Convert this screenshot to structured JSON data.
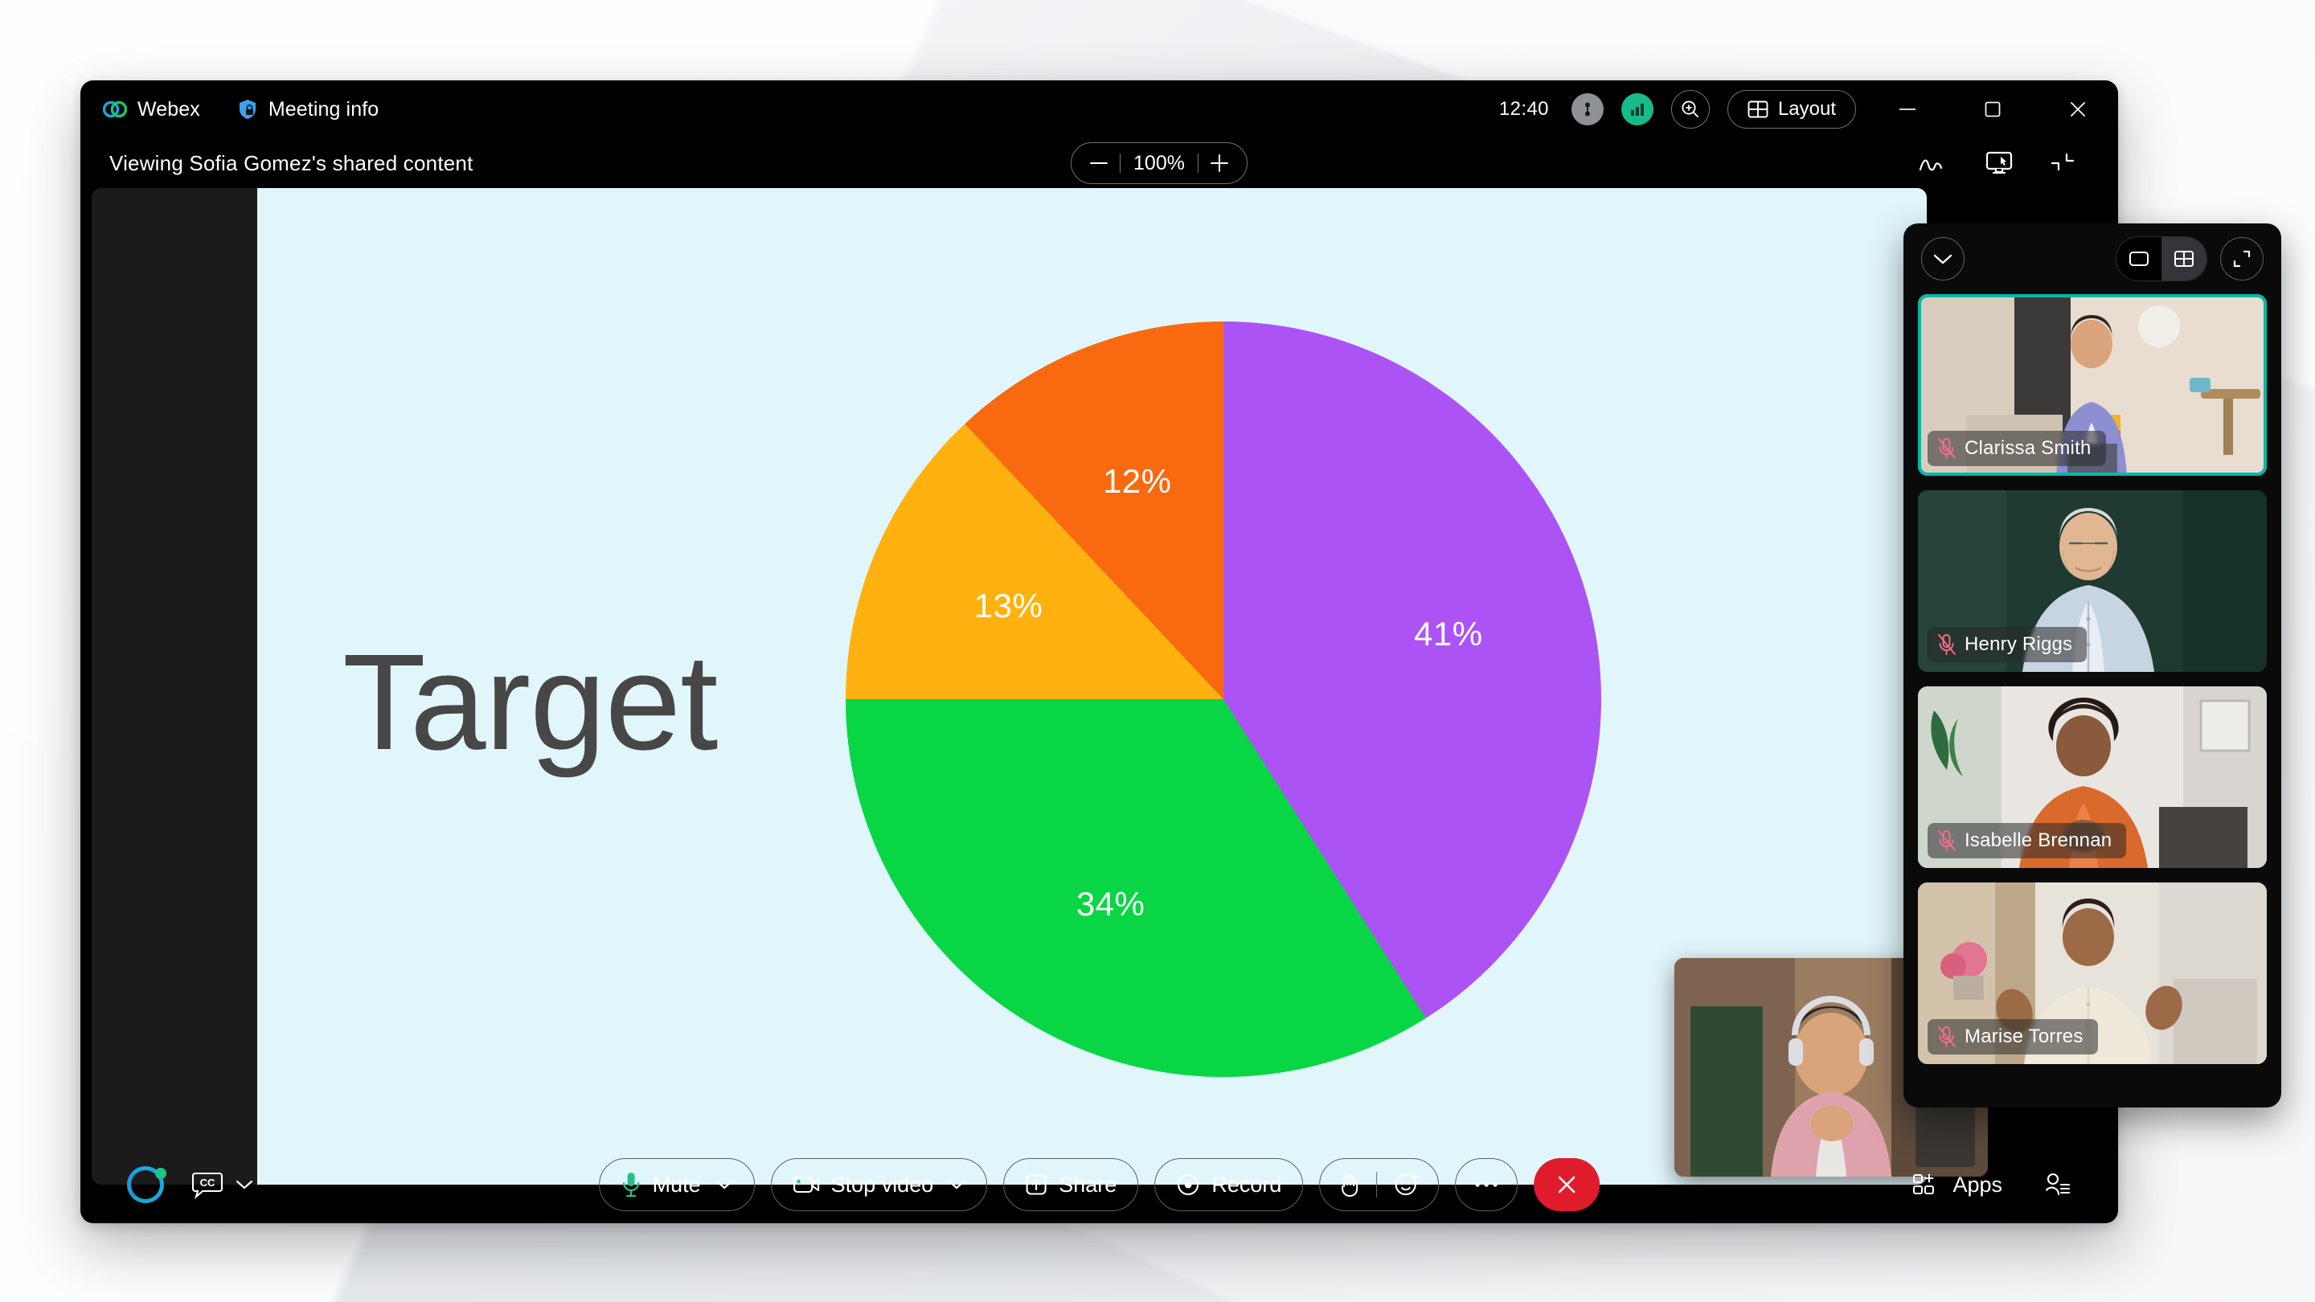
{
  "titlebar": {
    "app_name": "Webex",
    "meeting_info_label": "Meeting info",
    "clock": "12:40",
    "layout_label": "Layout",
    "icons": {
      "webex_logo": "webex-logo-icon",
      "meeting_info": "shield-lock-icon",
      "connection": "connection-icon",
      "network_quality": "signal-bars-icon",
      "search": "zoom-search-icon",
      "layout": "grid-layout-icon",
      "minimize": "minimize-icon",
      "maximize": "maximize-icon",
      "close": "close-icon"
    }
  },
  "sharebar": {
    "viewing_label": "Viewing Sofia Gomez's shared content",
    "zoom": {
      "minus_label": "−",
      "value": "100%",
      "plus_label": "+"
    },
    "right_icons": {
      "annotate": "annotate-scribble-icon",
      "remote_control": "remote-control-monitor-icon",
      "collapse_view": "collapse-corners-icon"
    }
  },
  "slide": {
    "title": "Target",
    "background_color": "#e1f6fb",
    "title_color": "#474747"
  },
  "chart_data": {
    "type": "pie",
    "title": "Target",
    "categories": [
      "Purple segment",
      "Green segment",
      "Amber segment",
      "Orange segment"
    ],
    "values": [
      41,
      34,
      13,
      12
    ],
    "labels": [
      "41%",
      "34%",
      "13%",
      "12%"
    ],
    "colors": [
      "#ab53f5",
      "#08d644",
      "#ffb20f",
      "#f96a10"
    ],
    "units": "percent",
    "total": 100,
    "legend": "none",
    "grid": false,
    "label_positions": [
      {
        "label": "41%",
        "x": 62,
        "y": 36
      },
      {
        "label": "34%",
        "x": 36,
        "y": 68
      },
      {
        "label": "13%",
        "x": 29,
        "y": 30
      },
      {
        "label": "12%",
        "x": 45,
        "y": 17
      }
    ],
    "start_angle_deg": 0,
    "rotation_note": "first slice (purple) starts at 12 o'clock and runs clockwise"
  },
  "filmstrip": {
    "controls": {
      "collapse": "chevron-down-icon",
      "view_single": "single-view-icon",
      "view_grid": "grid-view-icon",
      "expand": "expand-fullscreen-icon",
      "selected_view": "grid"
    },
    "participants": [
      {
        "name": "Clarissa Smith",
        "muted": true,
        "active_speaker": true
      },
      {
        "name": "Henry Riggs",
        "muted": true,
        "active_speaker": false
      },
      {
        "name": "Isabelle Brennan",
        "muted": true,
        "active_speaker": false
      },
      {
        "name": "Marise Torres",
        "muted": true,
        "active_speaker": false
      }
    ]
  },
  "selfview": {
    "label": "self-view"
  },
  "controlbar": {
    "assistant_label": "webex-assistant",
    "captions_label": "CC",
    "mute": {
      "label": "Mute",
      "icon": "microphone-icon"
    },
    "video": {
      "label": "Stop video",
      "icon": "camera-icon"
    },
    "share": {
      "label": "Share",
      "icon": "share-up-arrow-icon"
    },
    "record": {
      "label": "Record",
      "icon": "record-circle-icon"
    },
    "reactions": {
      "hand_icon": "raise-hand-icon",
      "emoji_icon": "smiley-plus-icon"
    },
    "more": {
      "label": "⋯",
      "icon": "more-options-icon"
    },
    "end_call": {
      "icon": "end-call-x-icon",
      "color": "#e01c2c"
    },
    "apps": {
      "label": "Apps",
      "icon": "apps-grid-plus-icon"
    },
    "participants": {
      "icon": "participants-list-icon"
    }
  }
}
